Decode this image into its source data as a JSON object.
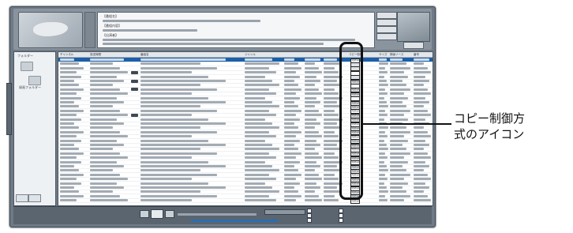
{
  "header": {
    "info_lines": [
      "【番組名】",
      "【番組内容】",
      "【出演者】"
    ],
    "buttons": [
      "",
      "",
      "",
      "",
      ""
    ]
  },
  "sidebar": {
    "title": "フォルダー",
    "items": [
      {
        "label": ""
      },
      {
        "label": "録画フォルダー"
      }
    ],
    "tabs": [
      "",
      ""
    ]
  },
  "table": {
    "columns": [
      "チャンネル",
      "放送時間",
      "",
      "番組名",
      "ジャンル",
      "",
      "",
      "",
      "",
      "",
      "コピー制御",
      "",
      "サイズ",
      "録画ソース",
      "番号"
    ],
    "rows": [
      {
        "selected": true,
        "badge": false,
        "copy": "1回のみ"
      },
      {
        "selected": false,
        "badge": false,
        "copy": ""
      },
      {
        "selected": false,
        "badge": false,
        "copy": ""
      },
      {
        "selected": false,
        "badge": true,
        "copy": ""
      },
      {
        "selected": false,
        "badge": false,
        "copy": ""
      },
      {
        "selected": false,
        "badge": true,
        "copy": "1回のみ"
      },
      {
        "selected": false,
        "badge": false,
        "copy": ""
      },
      {
        "selected": false,
        "badge": true,
        "copy": "1回のみ"
      },
      {
        "selected": false,
        "badge": false,
        "copy": "1回のみ"
      },
      {
        "selected": false,
        "badge": false,
        "copy": ""
      },
      {
        "selected": false,
        "badge": false,
        "copy": "1回のみ"
      },
      {
        "selected": false,
        "badge": false,
        "copy": "1回のみ"
      },
      {
        "selected": false,
        "badge": false,
        "copy": "1回のみ"
      },
      {
        "selected": false,
        "badge": true,
        "copy": "1回のみ"
      },
      {
        "selected": false,
        "badge": false,
        "copy": "1回のみ"
      },
      {
        "selected": false,
        "badge": false,
        "copy": "1回のみ"
      },
      {
        "selected": false,
        "badge": false,
        "copy": "1回のみ"
      },
      {
        "selected": false,
        "badge": false,
        "copy": "1回のみ"
      },
      {
        "selected": false,
        "badge": false,
        "copy": "1回のみ"
      },
      {
        "selected": false,
        "badge": false,
        "copy": "1回のみ"
      },
      {
        "selected": false,
        "badge": false,
        "copy": "1回のみ"
      },
      {
        "selected": false,
        "badge": false,
        "copy": "1回のみ"
      },
      {
        "selected": false,
        "badge": false,
        "copy": "1回のみ"
      },
      {
        "selected": false,
        "badge": false,
        "copy": "1回のみ"
      },
      {
        "selected": false,
        "badge": false,
        "copy": "1回のみ"
      },
      {
        "selected": false,
        "badge": false,
        "copy": "1回のみ"
      },
      {
        "selected": false,
        "badge": false,
        "copy": "1回のみ"
      },
      {
        "selected": false,
        "badge": false,
        "copy": "1回のみ"
      },
      {
        "selected": false,
        "badge": false,
        "copy": "1回のみ"
      },
      {
        "selected": false,
        "badge": false,
        "copy": "1回のみ"
      },
      {
        "selected": false,
        "badge": false,
        "copy": "1回のみ"
      },
      {
        "selected": false,
        "badge": false,
        "copy": "1回のみ"
      },
      {
        "selected": false,
        "badge": false,
        "copy": "1回のみ"
      },
      {
        "selected": false,
        "badge": false,
        "copy": "1回のみ"
      }
    ]
  },
  "footer": {
    "checkboxes": [
      "",
      "",
      ""
    ]
  },
  "annotation": {
    "callout_line1": "コピー制御方",
    "callout_line2": "式のアイコン"
  },
  "colors": {
    "app_frame": "#6e7a86",
    "selected_row": "#1d5fa8",
    "highlight": "#111111"
  }
}
